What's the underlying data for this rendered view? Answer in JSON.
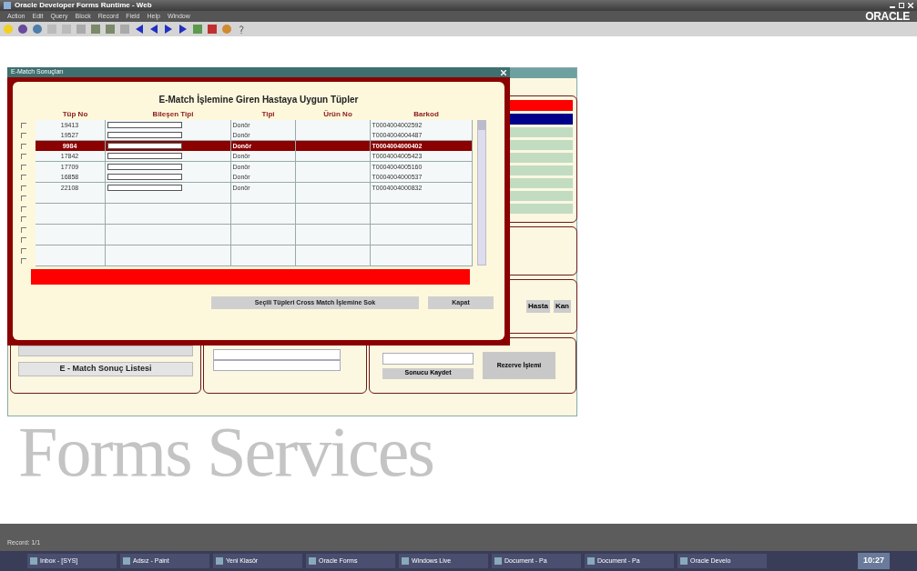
{
  "window": {
    "title": "Oracle Developer Forms Runtime - Web",
    "logo": "ORACLE"
  },
  "menu": [
    "Action",
    "Edit",
    "Query",
    "Block",
    "Record",
    "Field",
    "Help",
    "Window"
  ],
  "form_window": {
    "side_buttons": [
      "Hasta",
      "Kan"
    ],
    "list_button": "E - Match Sonuç Listesi",
    "save_button": "Sonucu Kaydet",
    "reserve_button": "Rezerve İşlemi"
  },
  "dialog": {
    "title": "E-Match Sonuçları",
    "heading": "E-Match İşlemine Giren Hastaya Uygun Tüpler",
    "columns": [
      "Tüp No",
      "Bileşen Tipi",
      "Tipi",
      "Ürün No",
      "Barkod"
    ],
    "rows": [
      {
        "tube_no": "19413",
        "type": "Donör",
        "product_no": "",
        "barcode": "T0004004002592",
        "selected": false,
        "checked": false
      },
      {
        "tube_no": "19527",
        "type": "Donör",
        "product_no": "",
        "barcode": "T0004004004487",
        "selected": false,
        "checked": false
      },
      {
        "tube_no": "9984",
        "type": "Donör",
        "product_no": "",
        "barcode": "T0004004000402",
        "selected": true,
        "checked": false
      },
      {
        "tube_no": "17842",
        "type": "Donör",
        "product_no": "",
        "barcode": "T0004004005423",
        "selected": false,
        "checked": false
      },
      {
        "tube_no": "17709",
        "type": "Donör",
        "product_no": "",
        "barcode": "T0004004005160",
        "selected": false,
        "checked": false
      },
      {
        "tube_no": "16858",
        "type": "Donör",
        "product_no": "",
        "barcode": "T0004004000537",
        "selected": false,
        "checked": false
      },
      {
        "tube_no": "22108",
        "type": "Donör",
        "product_no": "",
        "barcode": "T0004004000832",
        "selected": false,
        "checked": false
      }
    ],
    "empty_rows": [
      {
        "checked": false
      },
      {
        "checked": false
      },
      {
        "checked": false
      },
      {
        "checked": false
      },
      {
        "checked": false
      },
      {
        "checked": false
      },
      {
        "checked": false
      }
    ],
    "buttons": [
      "Seçili Tüpleri Cross Match İşlemine Sok",
      "Kapat"
    ]
  },
  "background_text": "Forms Services",
  "status_bar": "Record: 1/1",
  "taskbar": {
    "items": [
      "Inbox - [SYS]",
      "Adsız - Paint",
      "Yeni Klasör",
      "Oracle Forms",
      "Windows Live",
      "Document - Pa",
      "Document - Pa",
      "Oracle Develo"
    ],
    "clock": "10:27"
  }
}
